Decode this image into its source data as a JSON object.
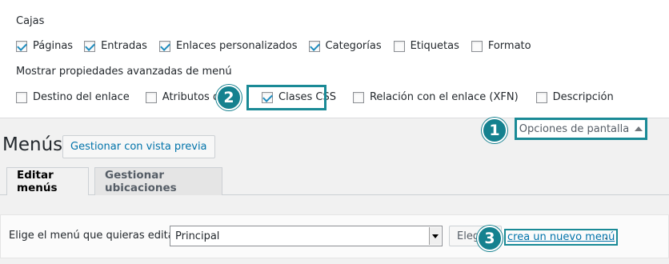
{
  "screen_options": {
    "boxes_heading": "Cajas",
    "boxes": [
      {
        "label": "Páginas",
        "checked": true
      },
      {
        "label": "Entradas",
        "checked": true
      },
      {
        "label": "Enlaces personalizados",
        "checked": true
      },
      {
        "label": "Categorías",
        "checked": true
      },
      {
        "label": "Etiquetas",
        "checked": false
      },
      {
        "label": "Formato",
        "checked": false
      }
    ],
    "advanced_heading": "Mostrar propiedades avanzadas de menú",
    "advanced": [
      {
        "label": "Destino del enlace",
        "checked": false
      },
      {
        "label": "Atributos del t",
        "checked": false
      },
      {
        "label": "Clases CSS",
        "checked": true
      },
      {
        "label": "Relación con el enlace (XFN)",
        "checked": false
      },
      {
        "label": "Descripción",
        "checked": false
      }
    ],
    "toggle_label": "Opciones de pantalla"
  },
  "badges": [
    "1",
    "2",
    "3"
  ],
  "header": {
    "title": "Menús",
    "action_label": "Gestionar con vista previa"
  },
  "tabs": [
    {
      "label": "Editar menús",
      "active": true
    },
    {
      "label": "Gestionar ubicaciones",
      "active": false
    }
  ],
  "manage": {
    "label": "Elige el menú que quieras editar:",
    "selected": "Principal",
    "select_button": "Elegir",
    "create_link": "crea un nuevo menú",
    "trailing": "."
  },
  "colors": {
    "highlight": "#1a8a96",
    "badge": "#15818f",
    "link": "#0073aa"
  }
}
